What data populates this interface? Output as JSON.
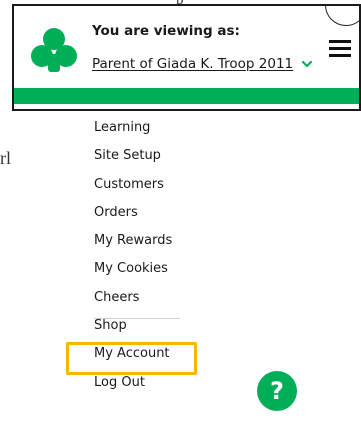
{
  "header": {
    "viewing_label": "You are viewing as:",
    "viewing_value": "Parent of Giada K. Troop 2011"
  },
  "menu": {
    "items": [
      {
        "label": "Learning"
      },
      {
        "label": "Site Setup"
      },
      {
        "label": "Customers"
      },
      {
        "label": "Orders"
      },
      {
        "label": "My Rewards"
      },
      {
        "label": "My Cookies"
      },
      {
        "label": "Cheers"
      },
      {
        "label": "Shop"
      },
      {
        "label": "My Account"
      },
      {
        "label": "Log Out"
      }
    ]
  },
  "help": {
    "label": "?"
  },
  "fragments": {
    "top_text": "p",
    "left_text": "rl"
  },
  "colors": {
    "brand_green": "#00ae58",
    "highlight": "#f5b800"
  },
  "icons": {
    "logo": "trefoil-icon",
    "select": "chevron-down-icon",
    "menu_toggle": "hamburger-icon",
    "help": "question-mark-icon"
  }
}
